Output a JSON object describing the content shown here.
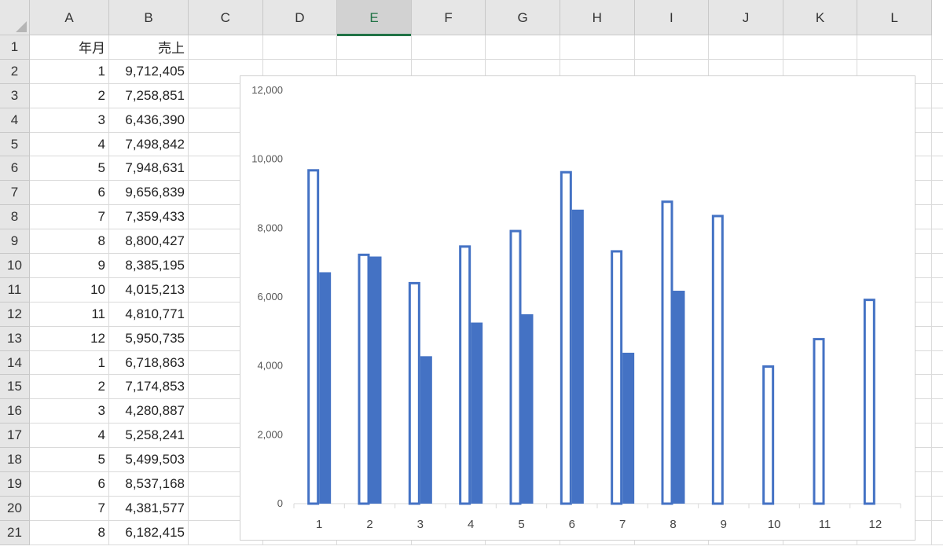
{
  "spreadsheet": {
    "columns": [
      "A",
      "B",
      "C",
      "D",
      "E",
      "F",
      "G",
      "H",
      "I",
      "J",
      "K",
      "L"
    ],
    "selected_column": "E",
    "rows": [
      {
        "num": "1",
        "a": "年月",
        "b": "売上"
      },
      {
        "num": "2",
        "a": "1",
        "b": "9,712,405"
      },
      {
        "num": "3",
        "a": "2",
        "b": "7,258,851"
      },
      {
        "num": "4",
        "a": "3",
        "b": "6,436,390"
      },
      {
        "num": "5",
        "a": "4",
        "b": "7,498,842"
      },
      {
        "num": "6",
        "a": "5",
        "b": "7,948,631"
      },
      {
        "num": "7",
        "a": "6",
        "b": "9,656,839"
      },
      {
        "num": "8",
        "a": "7",
        "b": "7,359,433"
      },
      {
        "num": "9",
        "a": "8",
        "b": "8,800,427"
      },
      {
        "num": "10",
        "a": "9",
        "b": "8,385,195"
      },
      {
        "num": "11",
        "a": "10",
        "b": "4,015,213"
      },
      {
        "num": "12",
        "a": "11",
        "b": "4,810,771"
      },
      {
        "num": "13",
        "a": "12",
        "b": "5,950,735"
      },
      {
        "num": "14",
        "a": "1",
        "b": "6,718,863"
      },
      {
        "num": "15",
        "a": "2",
        "b": "7,174,853"
      },
      {
        "num": "16",
        "a": "3",
        "b": "4,280,887"
      },
      {
        "num": "17",
        "a": "4",
        "b": "5,258,241"
      },
      {
        "num": "18",
        "a": "5",
        "b": "5,499,503"
      },
      {
        "num": "19",
        "a": "6",
        "b": "8,537,168"
      },
      {
        "num": "20",
        "a": "7",
        "b": "4,381,577"
      },
      {
        "num": "21",
        "a": "8",
        "b": "6,182,415"
      }
    ]
  },
  "chart_data": {
    "type": "bar",
    "categories": [
      "1",
      "2",
      "3",
      "4",
      "5",
      "6",
      "7",
      "8",
      "9",
      "10",
      "11",
      "12"
    ],
    "series": [
      {
        "values": [
          9712,
          7259,
          6436,
          7499,
          7949,
          9657,
          7359,
          8800,
          8385,
          4015,
          4811,
          5951
        ],
        "style": "outline",
        "color": "#4472C4"
      },
      {
        "values": [
          6719,
          7175,
          4281,
          5258,
          5500,
          8537,
          4382,
          6182,
          null,
          null,
          null,
          null
        ],
        "style": "filled",
        "color": "#4472C4"
      }
    ],
    "yticks": [
      "0",
      "2,000",
      "4,000",
      "6,000",
      "8,000",
      "10,000",
      "12,000"
    ],
    "ylim": [
      0,
      12000
    ],
    "grid": false,
    "title": "",
    "xlabel": "",
    "ylabel": ""
  }
}
